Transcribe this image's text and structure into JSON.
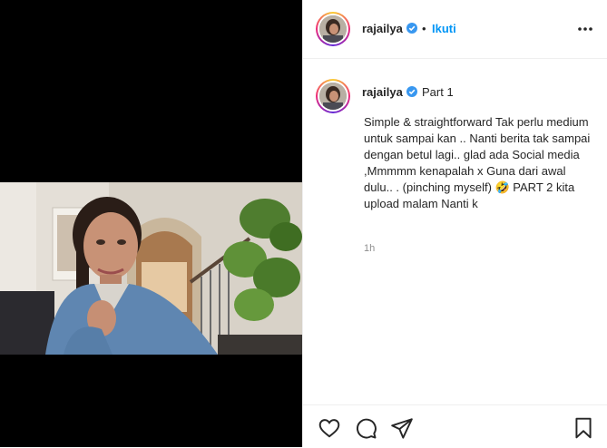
{
  "header": {
    "username": "rajailya",
    "separator": "•",
    "follow_label": "Ikuti",
    "more_icon": "more-horizontal-icon"
  },
  "caption": {
    "username": "rajailya",
    "first_line": "Part 1",
    "text": "Simple & straightforward Tak perlu medium untuk sampai kan .. Nanti berita tak sampai dengan betul lagi.. glad ada Social media ,Mmmmm kenapalah x Guna dari awal dulu.. . (pinching myself) 🤣 PART 2 kita upload malam Nanti k",
    "timestamp": "1h"
  },
  "actions": {
    "icons": [
      "heart-icon",
      "comment-icon",
      "share-icon",
      "bookmark-icon"
    ]
  },
  "colors": {
    "link": "#0095f6",
    "verified": "#3897f0",
    "text": "#262626",
    "muted": "#8e8e8e"
  }
}
